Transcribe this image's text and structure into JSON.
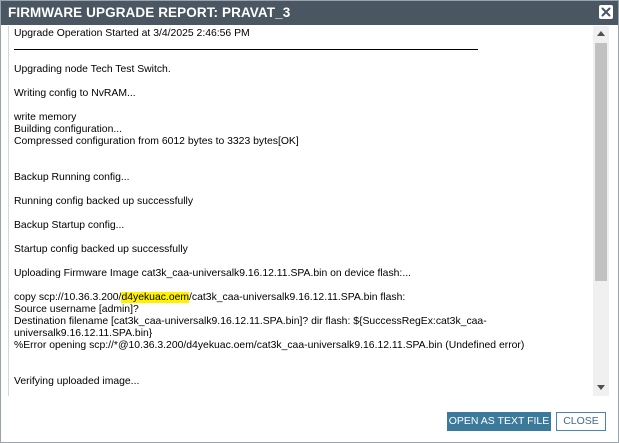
{
  "dialog": {
    "title": "FIRMWARE UPGRADE REPORT: PRAVAT_3",
    "close_icon": "close-icon"
  },
  "log": {
    "lines": [
      "Upgrade Operation Started at 3/4/2025 2:46:56 PM",
      "Upgrading node Tech Test Switch.",
      "Writing config to NvRAM...",
      "write memory",
      "Building configuration...",
      "Compressed configuration from 6012 bytes to 3323 bytes[OK]",
      "Backup Running config...",
      "Running config backed up successfully",
      "Backup Startup config...",
      "Startup config backed up successfully",
      "Uploading Firmware Image cat3k_caa-universalk9.16.12.11.SPA.bin on device flash:...",
      "Source username [admin]?",
      "Destination filename [cat3k_caa-universalk9.16.12.11.SPA.bin]? dir flash: ${SuccessRegEx:cat3k_caa-",
      "universalk9.16.12.11.SPA.bin}",
      "%Error opening scp://*@10.36.3.200/d4yekuac.oem/cat3k_caa-universalk9.16.12.11.SPA.bin (Undefined error)",
      "Verifying uploaded image..."
    ],
    "copy_line": {
      "prefix": "copy scp://10.36.3.200/",
      "highlight": "d4yekuac.oem",
      "suffix": "/cat3k_caa-universalk9.16.12.11.SPA.bin flash:"
    },
    "highlight_color": "#fff200"
  },
  "buttons": {
    "open_as_text": "OPEN AS TEXT FILE",
    "close": "CLOSE"
  },
  "colors": {
    "titlebar": "#4a5762",
    "primary_button": "#3b7a9a"
  }
}
